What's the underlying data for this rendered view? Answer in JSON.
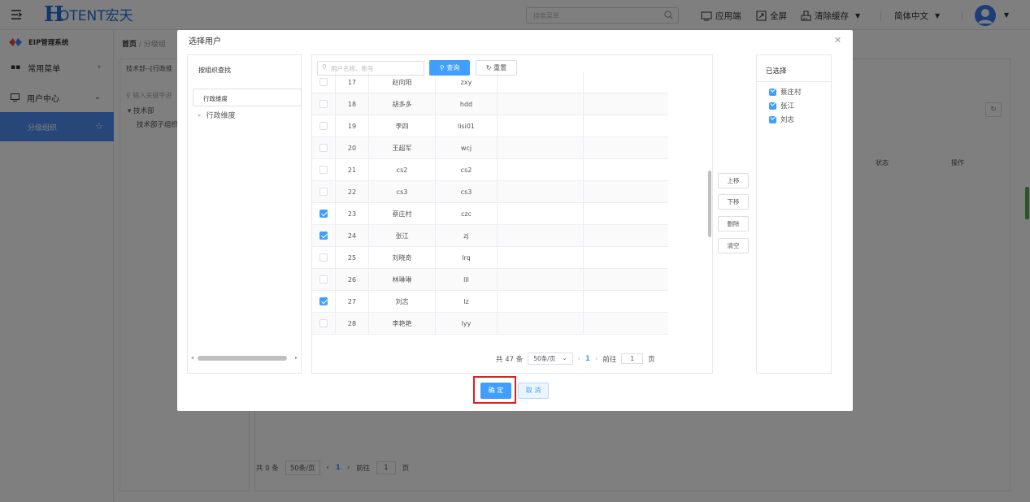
{
  "header": {
    "logo_letter": "H",
    "logo_text": "OTENT宏天",
    "search_placeholder": "搜索菜单",
    "app_label": "应用端",
    "fullscreen_label": "全屏",
    "clear_cache_label": "清除缓存",
    "language_label": "简体中文"
  },
  "sidebar": {
    "system_title": "EIP管理系统",
    "items": [
      {
        "label": "常用菜单"
      },
      {
        "label": "用户中心"
      }
    ],
    "active_item": "分级组织"
  },
  "breadcrumb": {
    "home": "首页",
    "current": "分级组"
  },
  "background": {
    "tab_label": "技术部--[行政维",
    "filter_placeholder": "输入关键字进",
    "tree_root": "技术部",
    "tree_child": "技术部子组织",
    "col_status": "状态",
    "col_ops": "操作",
    "pager": {
      "total": "共 0 条",
      "page_size": "50条/页",
      "page": "1",
      "goto_label": "前往",
      "goto_value": "1",
      "page_unit": "页"
    }
  },
  "dialog": {
    "title": "选择用户",
    "org_pane_title": "按组织查找",
    "dimension_select": "行政维度",
    "tree_node": "行政维度",
    "user_search_placeholder": "用户名称、账号",
    "query_label": "查询",
    "reset_label": "重置",
    "rows": [
      {
        "idx": "17",
        "name": "赵向阳",
        "account": "zxy",
        "checked": false
      },
      {
        "idx": "18",
        "name": "胡多多",
        "account": "hdd",
        "checked": false
      },
      {
        "idx": "19",
        "name": "李四",
        "account": "lisi01",
        "checked": false
      },
      {
        "idx": "20",
        "name": "王超军",
        "account": "wcj",
        "checked": false
      },
      {
        "idx": "21",
        "name": "cs2",
        "account": "cs2",
        "checked": false
      },
      {
        "idx": "22",
        "name": "cs3",
        "account": "cs3",
        "checked": false
      },
      {
        "idx": "23",
        "name": "蔡庄村",
        "account": "czc",
        "checked": true
      },
      {
        "idx": "24",
        "name": "张江",
        "account": "zj",
        "checked": true
      },
      {
        "idx": "25",
        "name": "刘晓奇",
        "account": "lrq",
        "checked": false
      },
      {
        "idx": "26",
        "name": "林琳琳",
        "account": "lll",
        "checked": false
      },
      {
        "idx": "27",
        "name": "刘志",
        "account": "lz",
        "checked": true
      },
      {
        "idx": "28",
        "name": "李艳艳",
        "account": "lyy",
        "checked": false
      }
    ],
    "pager": {
      "total": "共 47 条",
      "page_size": "50条/页",
      "page": "1",
      "goto_label": "前往",
      "goto_value": "1",
      "page_unit": "页"
    },
    "side_buttons": {
      "up": "上移",
      "down": "下移",
      "delete": "删除",
      "clear": "清空"
    },
    "selected_title": "已选择",
    "selected": [
      "蔡庄村",
      "张江",
      "刘志"
    ],
    "ok_label": "确 定",
    "cancel_label": "取 消"
  },
  "colors": {
    "primary": "#409eff",
    "brand": "#1e6fd9",
    "highlight_frame": "#e02020"
  }
}
